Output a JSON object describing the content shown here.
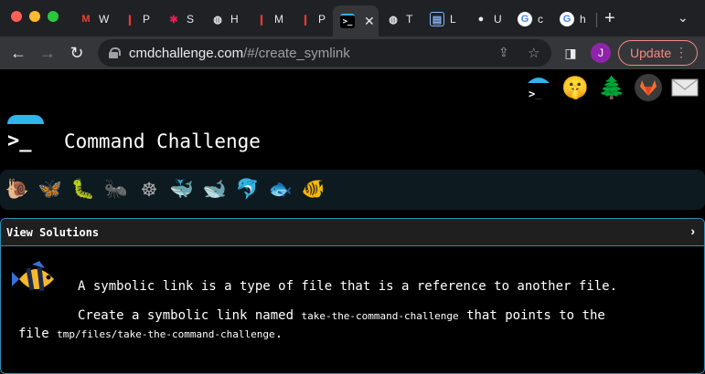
{
  "browser": {
    "tabs": [
      {
        "favicon": "gmail-icon",
        "label": "W"
      },
      {
        "favicon": "red-app-icon",
        "label": "P"
      },
      {
        "favicon": "slack-icon",
        "label": "S"
      },
      {
        "favicon": "globe-icon",
        "label": "H"
      },
      {
        "favicon": "red-app-icon",
        "label": "M"
      },
      {
        "favicon": "red-app-icon",
        "label": "P"
      },
      {
        "favicon": "terminal-icon",
        "label": "",
        "active": true
      },
      {
        "favicon": "globe-icon",
        "label": "T"
      },
      {
        "favicon": "docs-icon",
        "label": "L"
      },
      {
        "favicon": "github-icon",
        "label": "U"
      },
      {
        "favicon": "google-icon",
        "label": "c"
      },
      {
        "favicon": "google-icon",
        "label": "h"
      }
    ],
    "address": {
      "host": "cmdchallenge.com",
      "path": "/#/create_symlink"
    },
    "profile_initial": "J",
    "update_label": "Update"
  },
  "page": {
    "title": "Command Challenge",
    "logo_prompt": ">_",
    "top_icons": [
      "cmdchallenge-icon",
      "shush-emoji-icon",
      "tree-icon",
      "gitlab-icon",
      "envelope-icon"
    ],
    "levels": [
      {
        "icon": "snail-icon",
        "glyph": "🐌"
      },
      {
        "icon": "butterfly-icon",
        "glyph": "🦋"
      },
      {
        "icon": "caterpillar-icon",
        "glyph": "🐛"
      },
      {
        "icon": "ant-icon",
        "glyph": "🐜"
      },
      {
        "icon": "ship-wheel-icon",
        "glyph": "☸"
      },
      {
        "icon": "whale-icon",
        "glyph": "🐳"
      },
      {
        "icon": "whale-2-icon",
        "glyph": "🐋"
      },
      {
        "icon": "dolphin-icon",
        "glyph": "🐬"
      },
      {
        "icon": "fish-icon",
        "glyph": "🐟"
      },
      {
        "icon": "tropical-fish-icon",
        "glyph": "🐠",
        "active": true
      }
    ],
    "panel_header": "View Solutions",
    "description": {
      "line1": "A symbolic link is a type of file that is a reference to another file.",
      "line2_pre": "Create a symbolic link named",
      "line2_code": "take-the-command-challenge",
      "line2_post": "that points to the",
      "line3_pre": "file",
      "line3_code": "tmp/files/take-the-command-challenge",
      "line3_post": "."
    }
  },
  "colors": {
    "accent": "#2c8fb8",
    "umbrella": "#30b4ea",
    "update": "#f28b82"
  }
}
